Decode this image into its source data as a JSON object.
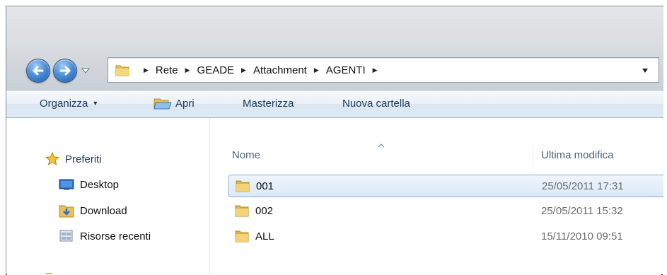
{
  "navigation": {
    "breadcrumbs": [
      "Rete",
      "GEADE",
      "Attachment",
      "AGENTI"
    ]
  },
  "toolbar": {
    "organize_label": "Organizza",
    "open_label": "Apri",
    "burn_label": "Masterizza",
    "new_folder_label": "Nuova cartella"
  },
  "sidebar": {
    "favorites_label": "Preferiti",
    "items": [
      {
        "label": "Desktop",
        "icon": "desktop-icon"
      },
      {
        "label": "Download",
        "icon": "download-folder-icon"
      },
      {
        "label": "Risorse recenti",
        "icon": "recent-places-icon"
      }
    ]
  },
  "file_list": {
    "columns": [
      "Nome",
      "Ultima modifica"
    ],
    "rows": [
      {
        "name": "001",
        "modified": "25/05/2011 17:31",
        "selected": true
      },
      {
        "name": "002",
        "modified": "25/05/2011 15:32",
        "selected": false
      },
      {
        "name": "ALL",
        "modified": "15/11/2010 09:51",
        "selected": false
      }
    ]
  },
  "colors": {
    "accent": "#1e395b",
    "selection_border": "#84acdd",
    "folder": "#e8c15a"
  }
}
